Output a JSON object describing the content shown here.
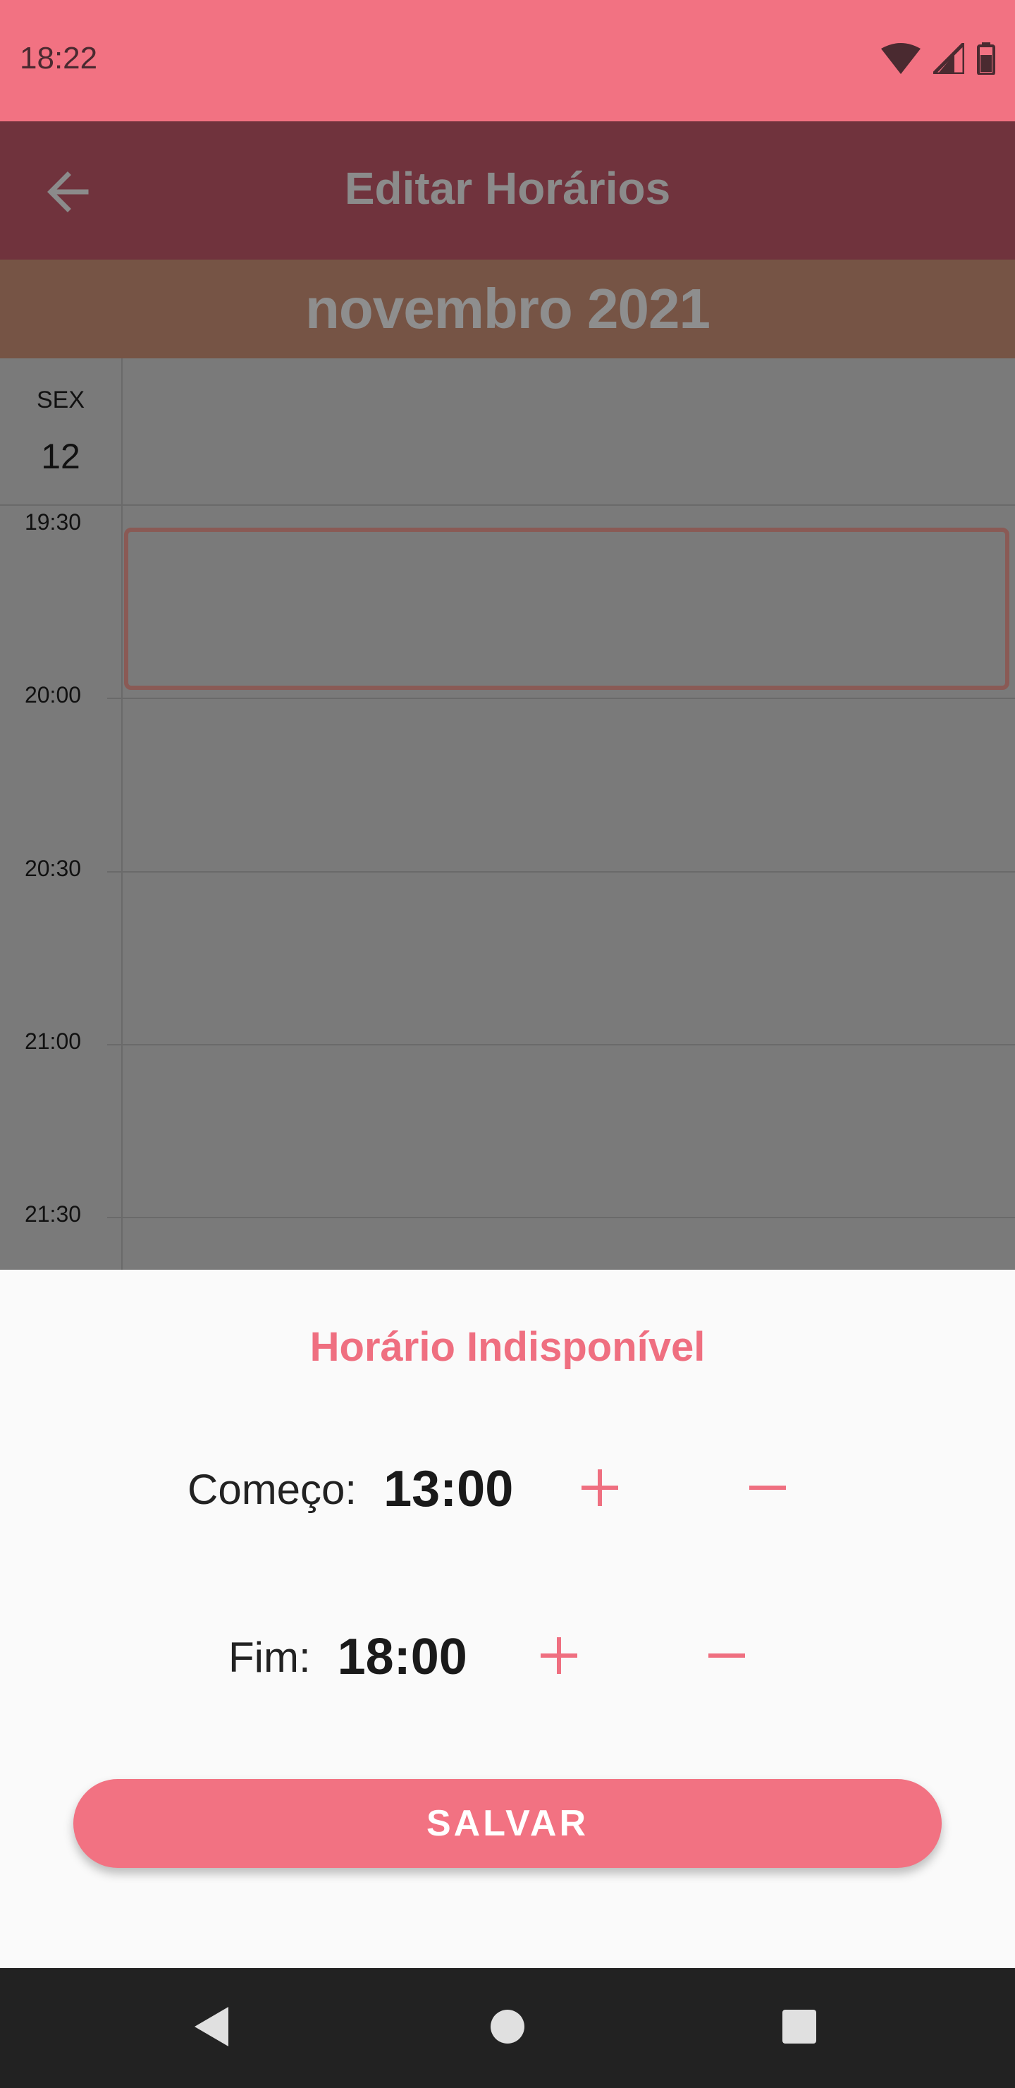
{
  "status_bar": {
    "time": "18:22",
    "icons": [
      "wifi-icon",
      "signal-icon",
      "battery-icon"
    ]
  },
  "app_bar": {
    "title": "Editar Horários",
    "back_icon": "arrow-left-icon"
  },
  "month": {
    "label": "novembro 2021"
  },
  "calendar": {
    "day_name": "SEX",
    "day_number": "12",
    "time_slots": [
      "19:30",
      "20:00",
      "20:30",
      "21:00",
      "21:30"
    ]
  },
  "sheet": {
    "title": "Horário Indisponível",
    "start": {
      "label": "Começo:",
      "value": "13:00"
    },
    "end": {
      "label": "Fim:",
      "value": "18:00"
    },
    "save_label": "SALVAR"
  },
  "nav_bar": {
    "icons": [
      "back-triangle-icon",
      "home-circle-icon",
      "recents-square-icon"
    ]
  },
  "colors": {
    "accent": "#f27282",
    "app_bar_dimmed": "#70333d",
    "month_bar_dimmed": "#765445",
    "overlay_gray": "#7a7a7a",
    "sheet_bg": "#fafafa",
    "nav_bar": "#222222"
  }
}
